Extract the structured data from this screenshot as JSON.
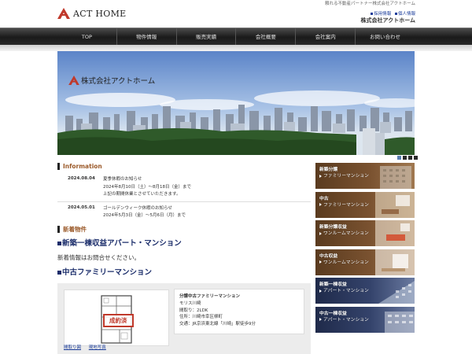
{
  "header": {
    "logo_text": "ACT HOME",
    "tagline": "頼れる不動産パートナー株式会社アクトホーム",
    "links": [
      "採用情報",
      "個人情報"
    ],
    "company_name": "株式会社アクトホーム"
  },
  "nav": {
    "items": [
      "TOP",
      "物件情報",
      "販売実績",
      "会社概要",
      "会社案内",
      "お問い合わせ"
    ]
  },
  "hero": {
    "title": "株式会社アクトホーム"
  },
  "information": {
    "heading": "Information",
    "items": [
      {
        "date": "2024.08.04",
        "title": "夏季休暇のお知らせ",
        "line1": "2024年8月10日（土）～8月18日（金）まで",
        "line2": "上記の期間休業とさせていただきます。"
      },
      {
        "date": "2024.05.01",
        "title": "ゴールデンウィーク休暇のお知らせ",
        "line1": "2024年5月3日（金）～5月6日（月）まで"
      }
    ]
  },
  "new_listings": {
    "heading": "新着物件",
    "category1": "新築一棟収益アパート・マンション",
    "note": "新着情報はお問合せください。",
    "category2": "中古ファミリーマンション"
  },
  "listing": {
    "sold_label": "成約済",
    "link1": "間取り図",
    "link2": "現地写真",
    "title": "分譲中古ファミリーマンション",
    "name": "モリス川崎",
    "layout": "間取り：2LDK",
    "address": "住所：川崎市幸区柳町",
    "access": "交通：JR京浜東北線「川崎」駅徒歩9分"
  },
  "banners": [
    {
      "line1": "新築分譲",
      "line2": "ファミリーマンション",
      "style": "brown"
    },
    {
      "line1": "中古",
      "line2": "ファミリーマンション",
      "style": "brown"
    },
    {
      "line1": "新築分譲収益",
      "line2": "ワンルームマンション",
      "style": "brown"
    },
    {
      "line1": "中古収益",
      "line2": "ワンルームマンション",
      "style": "brown"
    },
    {
      "line1": "新築一棟収益",
      "line2": "アパート・マンション",
      "style": "navy"
    },
    {
      "line1": "中古一棟収益",
      "line2": "アパート・マンション",
      "style": "navy"
    }
  ],
  "colors": {
    "brand_red": "#c0392b",
    "nav_dark": "#1a1a1a",
    "heading_blue": "#1a2c6a",
    "info_brown": "#9b5a2a"
  }
}
